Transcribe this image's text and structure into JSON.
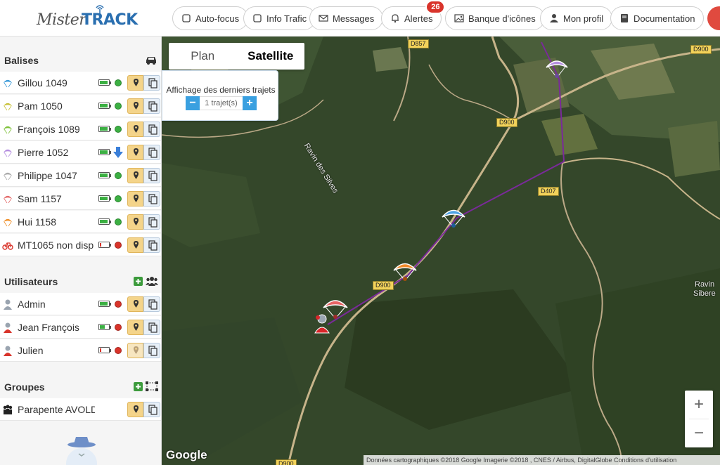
{
  "app": {
    "logo_part1": "Mister",
    "logo_part2": "TRACK"
  },
  "toolbar": {
    "autofocus": "Auto-focus",
    "traffic": "Info Trafic",
    "messages": "Messages",
    "alerts": "Alertes",
    "alerts_count": "26",
    "icons": "Banque d'icônes",
    "profile": "Mon profil",
    "docs": "Documentation"
  },
  "sidebar": {
    "beacons_title": "Balises",
    "beacons": [
      {
        "name": "Gillou 1049",
        "color": "#3a9ad9",
        "battery": 0.9,
        "status": "#3cb043"
      },
      {
        "name": "Pam 1050",
        "color": "#c9c23a",
        "battery": 0.9,
        "status": "#3cb043"
      },
      {
        "name": "François 1089",
        "color": "#7fc23a",
        "battery": 0.9,
        "status": "#3cb043"
      },
      {
        "name": "Pierre 1052",
        "color": "#b58ee0",
        "battery": 0.9,
        "status": "arrow"
      },
      {
        "name": "Philippe 1047",
        "color": "#aaaaaa",
        "battery": 0.9,
        "status": "#3cb043"
      },
      {
        "name": "Sam 1157",
        "color": "#e46b6b",
        "battery": 0.9,
        "status": "#3cb043"
      },
      {
        "name": "Hui 1158",
        "color": "#f0902a",
        "battery": 0.9,
        "status": "#3cb043"
      },
      {
        "name": "MT1065 non disp",
        "color": "#d9342b",
        "battery": 0.2,
        "status": "#d9342b",
        "icon": "bike"
      }
    ],
    "users_title": "Utilisateurs",
    "users": [
      {
        "name": "Admin",
        "battery": 0.9,
        "status": "#d9342b"
      },
      {
        "name": "Jean François",
        "battery": 0.6,
        "status": "#d9342b"
      },
      {
        "name": "Julien",
        "battery": 0.2,
        "status": "#d9342b"
      }
    ],
    "groups_title": "Groupes",
    "groups": [
      {
        "name": "Parapente AVOLDA"
      }
    ]
  },
  "map": {
    "type_plan": "Plan",
    "type_satellite": "Satellite",
    "trajets_label": "Affichage des derniers trajets",
    "trajets_count": "1 trajet(s)",
    "zoom_in": "+",
    "zoom_out": "−",
    "google": "Google",
    "attribution": "Données cartographiques ©2018 Google Imagerie ©2018 , CNES / Airbus, DigitalGlobe    Conditions d'utilisation",
    "roads": [
      "D857",
      "D900",
      "D900",
      "D407",
      "D900",
      "D900"
    ],
    "labels": [
      "Ravin des Silves",
      "Ravin",
      "Sibere"
    ]
  }
}
